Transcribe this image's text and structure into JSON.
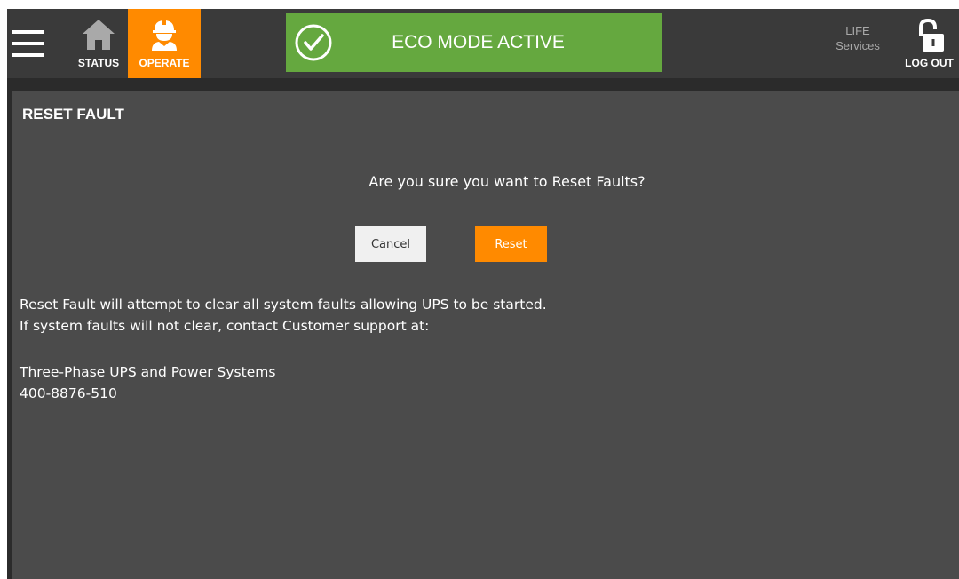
{
  "header": {
    "tabs": [
      {
        "label": "STATUS",
        "icon": "home-icon"
      },
      {
        "label": "OPERATE",
        "icon": "worker-helmet-icon"
      }
    ],
    "active_tab": "OPERATE",
    "eco_banner": {
      "text": "ECO MODE ACTIVE",
      "icon": "check-circle-icon"
    },
    "life_services": {
      "line1": "LIFE",
      "line2": "Services"
    },
    "logout": {
      "label": "LOG OUT",
      "icon": "unlock-icon"
    }
  },
  "panel": {
    "title": "RESET FAULT",
    "question": "Are you sure you want to Reset Faults?",
    "buttons": {
      "cancel": "Cancel",
      "reset": "Reset"
    },
    "info": {
      "line1": "Reset Fault will attempt to clear all system faults allowing UPS to be started.",
      "line2": "If system faults will not clear, contact Customer support at:",
      "company": "Three-Phase UPS and Power Systems",
      "phone": "400-8876-510"
    }
  },
  "colors": {
    "accent_orange": "#ff8a00",
    "eco_green": "#65a83f",
    "header_bg": "#3a3a3a",
    "panel_bg": "#4b4b4b"
  }
}
